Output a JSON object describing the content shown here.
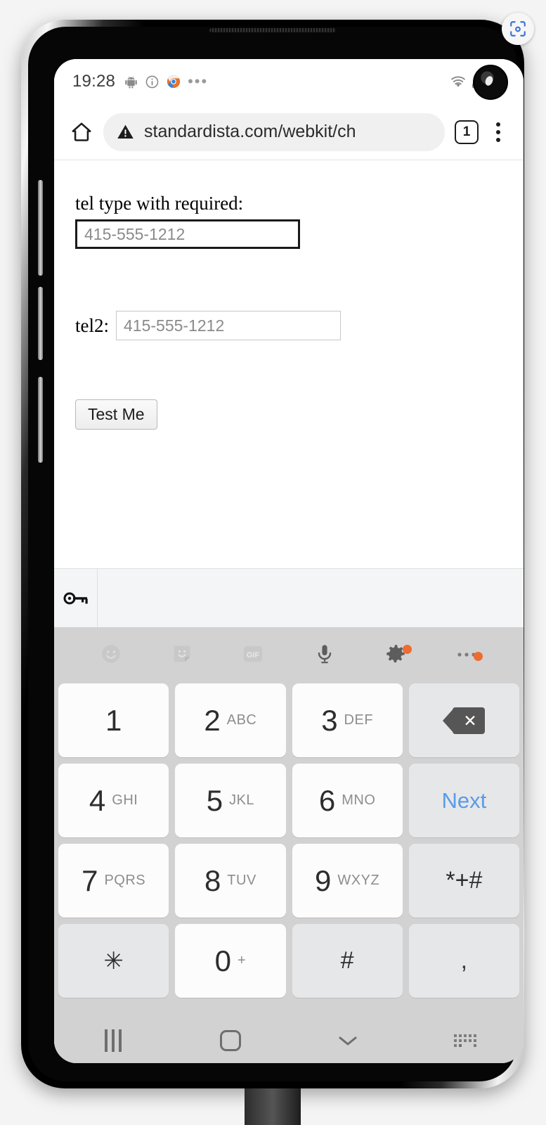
{
  "status_bar": {
    "time": "19:28",
    "icons_left": [
      "android-icon",
      "info-icon",
      "chrome-icon",
      "more-notifications-icon"
    ],
    "icons_right": [
      "wifi-icon",
      "signal-icon",
      "battery-icon"
    ],
    "camera": "front-camera-cutout"
  },
  "browser": {
    "home_icon": "home-icon",
    "security_icon": "not-secure-warning-icon",
    "url": "standardista.com/webkit/ch",
    "tab_count": "1",
    "overflow_icon": "overflow-menu-icon"
  },
  "webpage": {
    "tel1_label": "tel type with required:",
    "tel1_placeholder": "415-555-1212",
    "tel1_value": "",
    "tel2_label": "tel2:",
    "tel2_placeholder": "415-555-1212",
    "tel2_value": "",
    "submit_label": "Test Me"
  },
  "autofill_bar": {
    "key_icon": "password-key-icon"
  },
  "keyboard": {
    "toolbar": [
      {
        "name": "emoji-icon",
        "badge": false
      },
      {
        "name": "sticker-icon",
        "badge": false
      },
      {
        "name": "gif-icon",
        "label": "GIF",
        "badge": false
      },
      {
        "name": "microphone-icon",
        "badge": false
      },
      {
        "name": "settings-gear-icon",
        "badge": true
      },
      {
        "name": "keyboard-more-icon",
        "badge": true
      }
    ],
    "badge_color": "#ed6c30",
    "next_color": "#5b9be8",
    "rows": [
      [
        {
          "num": "1",
          "sub": "",
          "type": "digit"
        },
        {
          "num": "2",
          "sub": "ABC",
          "type": "digit"
        },
        {
          "num": "3",
          "sub": "DEF",
          "type": "digit"
        },
        {
          "num": "",
          "sub": "",
          "type": "backspace"
        }
      ],
      [
        {
          "num": "4",
          "sub": "GHI",
          "type": "digit"
        },
        {
          "num": "5",
          "sub": "JKL",
          "type": "digit"
        },
        {
          "num": "6",
          "sub": "MNO",
          "type": "digit"
        },
        {
          "num": "Next",
          "sub": "",
          "type": "next"
        }
      ],
      [
        {
          "num": "7",
          "sub": "PQRS",
          "type": "digit"
        },
        {
          "num": "8",
          "sub": "TUV",
          "type": "digit"
        },
        {
          "num": "9",
          "sub": "WXYZ",
          "type": "digit"
        },
        {
          "num": "*+#",
          "sub": "",
          "type": "symbol"
        }
      ],
      [
        {
          "num": "✳",
          "sub": "",
          "type": "symbol-gray"
        },
        {
          "num": "0",
          "sub": "+",
          "type": "digit"
        },
        {
          "num": "#",
          "sub": "",
          "type": "symbol-gray"
        },
        {
          "num": ",",
          "sub": "",
          "type": "symbol-gray"
        }
      ]
    ]
  },
  "nav_bar": {
    "recents_icon": "recents-icon",
    "home_icon": "home-nav-icon",
    "back_icon": "hide-keyboard-chevron-icon",
    "keyboard_switch_icon": "keyboard-switch-icon"
  },
  "overlay": {
    "scan_icon": "screenshot-scan-icon"
  }
}
